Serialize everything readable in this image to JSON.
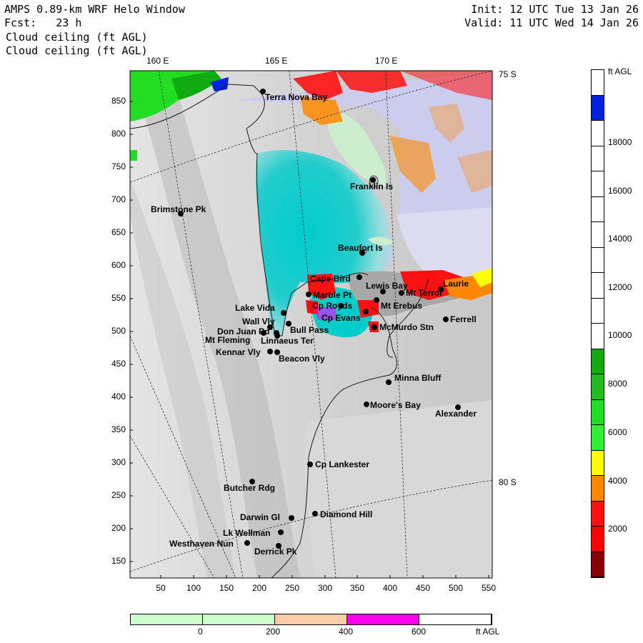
{
  "header": {
    "left_line1": "AMPS 0.89-km WRF Helo Window",
    "left_line2": "Fcst:   23 h",
    "left_line3": "Cloud ceiling (ft AGL)",
    "left_line4": "Cloud ceiling (ft AGL)",
    "right_line1": "Init: 12 UTC Tue 13 Jan 26",
    "right_line2": "Valid: 11 UTC Wed 14 Jan 26"
  },
  "map": {
    "top_lon_labels": [
      "160 E",
      "165 E",
      "170 E"
    ],
    "right_lat_labels": [
      "75 S",
      "80 S"
    ],
    "x_ticks": [
      "50",
      "100",
      "150",
      "200",
      "250",
      "300",
      "350",
      "400",
      "450",
      "500",
      "550"
    ],
    "y_ticks": [
      "850",
      "800",
      "750",
      "700",
      "650",
      "600",
      "550",
      "500",
      "450",
      "400",
      "350",
      "300",
      "250",
      "200",
      "150"
    ],
    "places": [
      {
        "name": "Terra Nova Bay"
      },
      {
        "name": "Franklin Is"
      },
      {
        "name": "Brimstone Pk"
      },
      {
        "name": "Beaufort Is"
      },
      {
        "name": "Cape Bird"
      },
      {
        "name": "Lewis Bay"
      },
      {
        "name": "Laurie"
      },
      {
        "name": "Mt Terror"
      },
      {
        "name": "Marble Pt"
      },
      {
        "name": "Cp Royds"
      },
      {
        "name": "Mt Erebus"
      },
      {
        "name": "Cp Evans"
      },
      {
        "name": "Ferrell"
      },
      {
        "name": "Lake Vida"
      },
      {
        "name": "Wall Vly"
      },
      {
        "name": "Bull Pass"
      },
      {
        "name": "Don Juan Pd"
      },
      {
        "name": "McMurdo Stn"
      },
      {
        "name": "Mt Fleming"
      },
      {
        "name": "Linnaeus Ter"
      },
      {
        "name": "Kennar Vly"
      },
      {
        "name": "Beacon Vly"
      },
      {
        "name": "Minna Bluff"
      },
      {
        "name": "Moore's Bay"
      },
      {
        "name": "Alexander"
      },
      {
        "name": "Cp Lankester"
      },
      {
        "name": "Butcher Rdg"
      },
      {
        "name": "Diamond Hill"
      },
      {
        "name": "Darwin Gl"
      },
      {
        "name": "Lk Wellman"
      },
      {
        "name": "Westhaven Nun"
      },
      {
        "name": "Derrick Pk"
      }
    ]
  },
  "colorbar_right": {
    "title": "ft AGL",
    "labels": [
      "18000",
      "16000",
      "14000",
      "12000",
      "10000",
      "8000",
      "6000",
      "4000",
      "2000"
    ],
    "colors": [
      "#ffffff",
      "#0022dd",
      "#ffffff",
      "#ffffff",
      "#ffffff",
      "#ffffff",
      "#ffffff",
      "#ffffff",
      "#ffffff",
      "#ffffff",
      "#ffffff",
      "#11aa11",
      "#22bb22",
      "#22dd22",
      "#33ee33",
      "#ffff00",
      "#ff8800",
      "#ff1111",
      "#ff0000",
      "#880000"
    ]
  },
  "colorbar_bottom": {
    "labels": [
      "0",
      "200",
      "400",
      "600"
    ],
    "unit": "ft AGL",
    "colors": [
      "#ccffcc",
      "#ccffcc",
      "#ffccaa",
      "#ff00ee",
      "#ffffff"
    ]
  }
}
